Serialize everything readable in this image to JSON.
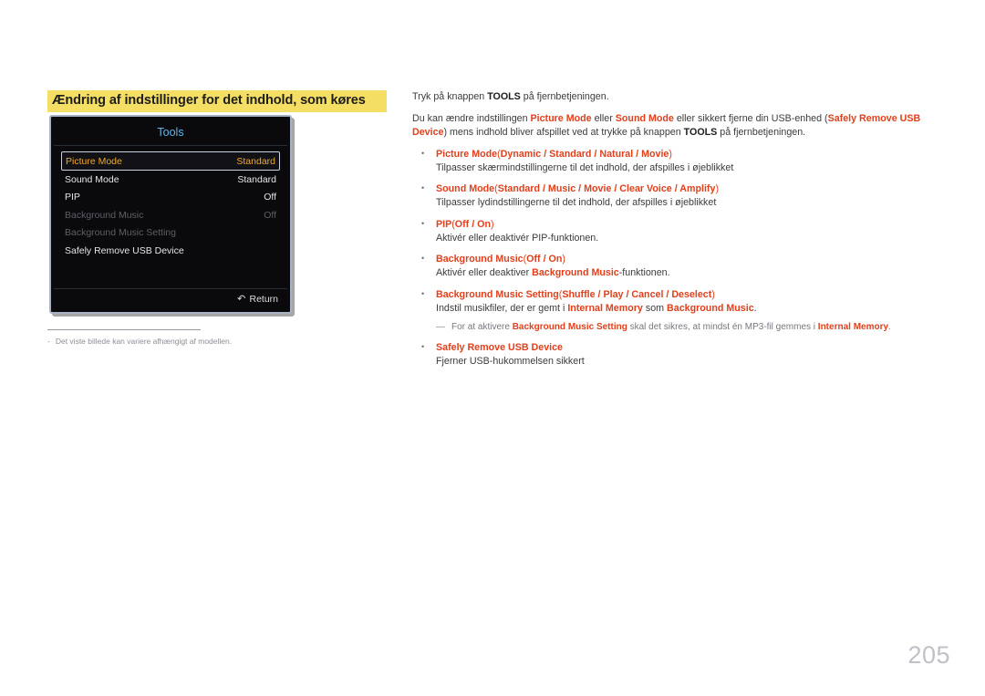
{
  "section": {
    "title": "Ændring af indstillinger for det indhold, som køres"
  },
  "tools_panel": {
    "header": "Tools",
    "rows": [
      {
        "label": "Picture Mode",
        "value": "Standard",
        "state": "selected"
      },
      {
        "label": "Sound Mode",
        "value": "Standard",
        "state": "normal"
      },
      {
        "label": "PIP",
        "value": "Off",
        "state": "normal"
      },
      {
        "label": "Background Music",
        "value": "Off",
        "state": "disabled"
      },
      {
        "label": "Background Music Setting",
        "value": "",
        "state": "disabled"
      },
      {
        "label": "Safely Remove USB Device",
        "value": "",
        "state": "normal"
      }
    ],
    "footer": {
      "return_label": "Return",
      "return_icon": "return-arrow-icon"
    },
    "colors": {
      "background": "#0a0a0d",
      "header_text": "#5cb6e8",
      "selected_text": "#f0a82a",
      "disabled_text": "#5e5e66"
    }
  },
  "footnote": {
    "dash": "-",
    "text": "Det viste billede kan variere afhængigt af modellen."
  },
  "body": {
    "intro_1": {
      "pre": "Tryk på knappen ",
      "key": "TOOLS",
      "post": " på fjernbetjeningen."
    },
    "intro_2": {
      "t1": "Du kan ændre indstillingen ",
      "r1": "Picture Mode",
      "t2": " eller ",
      "r2": "Sound Mode",
      "t3": " eller sikkert fjerne din USB-enhed (",
      "r3": "Safely Remove USB Device",
      "t4": ")",
      "t5": "mens indhold bliver afspillet ved at trykke på knappen ",
      "key": "TOOLS",
      "t6": " på fjernbetjeningen."
    },
    "bullets": [
      {
        "name": "Picture Mode",
        "options_open": "(",
        "options": "Dynamic / Standard / Natural / Movie",
        "options_close": ")",
        "desc": "Tilpasser skærmindstillingerne til det indhold, der afspilles i øjeblikket"
      },
      {
        "name": "Sound Mode",
        "options_open": "(",
        "options": "Standard / Music / Movie / Clear Voice / Amplify",
        "options_close": ")",
        "desc": "Tilpasser lydindstillingerne til det indhold, der afspilles i øjeblikket"
      },
      {
        "name": "PIP",
        "options_open": "(",
        "options": "Off / On",
        "options_close": ")",
        "desc": "Aktivér eller deaktivér PIP-funktionen."
      },
      {
        "name": "Background Music",
        "options_open": "(",
        "options": "Off / On",
        "options_close": ")",
        "desc_pre": "Aktivér eller deaktiver ",
        "desc_r": "Background Music",
        "desc_post": "-funktionen."
      },
      {
        "name": "Background Music Setting",
        "options_open": "(",
        "options": "Shuffle / Play / Cancel / Deselect",
        "options_close": ")",
        "desc_pre": "Indstil musikfiler, der er gemt i ",
        "desc_r1": "Internal Memory",
        "desc_mid": " som ",
        "desc_r2": "Background Music",
        "desc_post": "."
      },
      {
        "name": "Safely Remove USB Device",
        "desc": "Fjerner USB-hukommelsen sikkert"
      }
    ],
    "subnote": {
      "dash": "―",
      "t1": "For at aktivere ",
      "r1": "Background Music Setting",
      "t2": " skal det sikres, at mindst én MP3-fil gemmes i ",
      "r2": "Internal Memory",
      "t3": "."
    }
  },
  "page": {
    "number": "205"
  }
}
